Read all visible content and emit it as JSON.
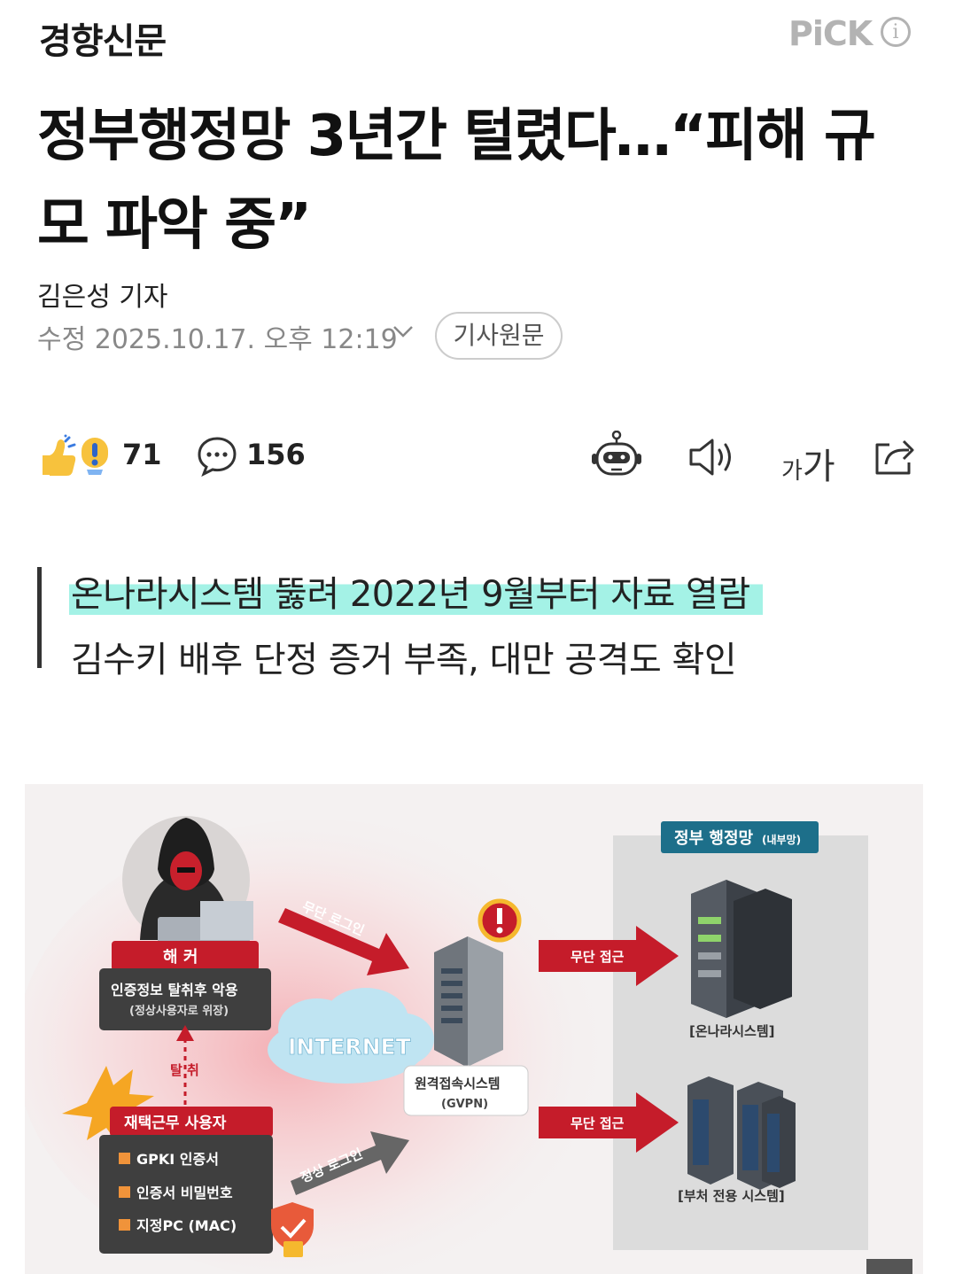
{
  "header": {
    "logo": "경향신문",
    "pick_label": "PiCK",
    "info_icon": "info-icon"
  },
  "article": {
    "title": "정부행정망 3년간 털렸다…“피해 규모 파악 중”",
    "author": "김은성 기자",
    "date": "수정 2025.10.17. 오후 12:19",
    "original_label": "기사원문"
  },
  "actions": {
    "reaction_count": "71",
    "comment_count": "156",
    "font_small": "가",
    "font_large": "가"
  },
  "subtitle": {
    "line1": "온나라시스템 뚫려 2022년 9월부터 자료 열람",
    "line2": "김수키 배후 단정 증거 부족, 대만 공격도 확인"
  },
  "infographic": {
    "hacker_title": "해  커",
    "hacker_desc1": "인증정보 탈취후 악용",
    "hacker_desc2": "(정상사용자로 위장)",
    "steal_label": "탈 취",
    "user_title": "재택근무 사용자",
    "user_items": [
      "GPKI 인증서",
      "인증서 비밀번호",
      "지정PC (MAC)"
    ],
    "internet_label": "INTERNET",
    "unauth_login": "무단 로그인",
    "normal_login": "정상 로그인",
    "gvpn_label1": "원격접속시스템",
    "gvpn_label2": "(GVPN)",
    "unauth_access1": "무단 접근",
    "unauth_access2": "무단 접근",
    "gov_network": "정부 행정망",
    "gov_network_sub": "(내부망)",
    "onnara_label": "[온나라시스템]",
    "dept_label": "[부처 전용 시스템]"
  }
}
